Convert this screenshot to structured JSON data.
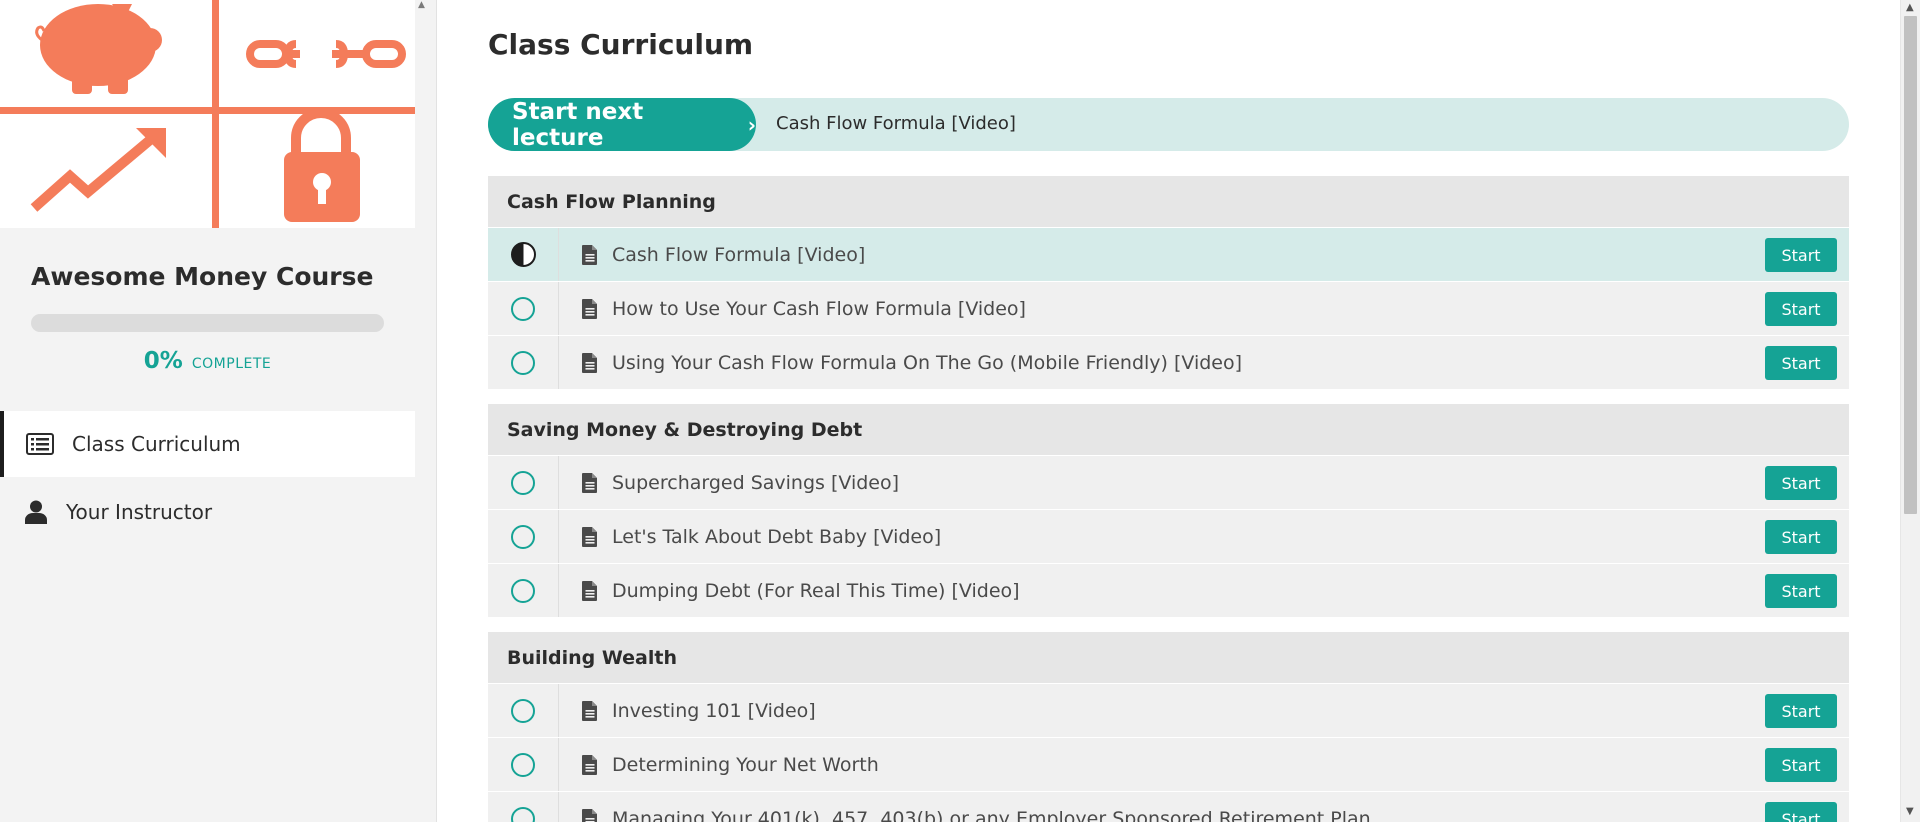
{
  "sidebar": {
    "hero_alt": "",
    "course_title": "Awesome Money Course",
    "progress": {
      "value": 0,
      "percent_label": "0%",
      "complete_label": "COMPLETE"
    },
    "nav": [
      {
        "label": "Class Curriculum",
        "icon": "list-icon",
        "active": true
      },
      {
        "label": "Your Instructor",
        "icon": "user-icon",
        "active": false
      }
    ]
  },
  "main": {
    "title": "Class Curriculum",
    "next_lecture": {
      "button_label": "Start next lecture",
      "chevron": "›",
      "lecture_title": "Cash Flow Formula [Video]"
    },
    "sections": [
      {
        "title": "Cash Flow Planning",
        "lectures": [
          {
            "title": "Cash Flow Formula [Video]",
            "status": "in-progress",
            "button": "Start"
          },
          {
            "title": "How to Use Your Cash Flow Formula [Video]",
            "status": "not-started",
            "button": "Start"
          },
          {
            "title": "Using Your Cash Flow Formula On The Go (Mobile Friendly) [Video]",
            "status": "not-started",
            "button": "Start"
          }
        ]
      },
      {
        "title": "Saving Money & Destroying Debt",
        "lectures": [
          {
            "title": "Supercharged Savings [Video]",
            "status": "not-started",
            "button": "Start"
          },
          {
            "title": "Let's Talk About Debt Baby [Video]",
            "status": "not-started",
            "button": "Start"
          },
          {
            "title": "Dumping Debt (For Real This Time) [Video]",
            "status": "not-started",
            "button": "Start"
          }
        ]
      },
      {
        "title": "Building Wealth",
        "lectures": [
          {
            "title": "Investing 101 [Video]",
            "status": "not-started",
            "button": "Start"
          },
          {
            "title": "Determining Your Net Worth",
            "status": "not-started",
            "button": "Start"
          },
          {
            "title": "Managing Your 401(k), 457, 403(b) or any Employer Sponsored Retirement Plan",
            "status": "not-started",
            "button": "Start"
          }
        ]
      }
    ]
  },
  "colors": {
    "accent": "#15a395",
    "accent_light": "#d5ebe9",
    "hero_orange": "#f47c5a"
  }
}
